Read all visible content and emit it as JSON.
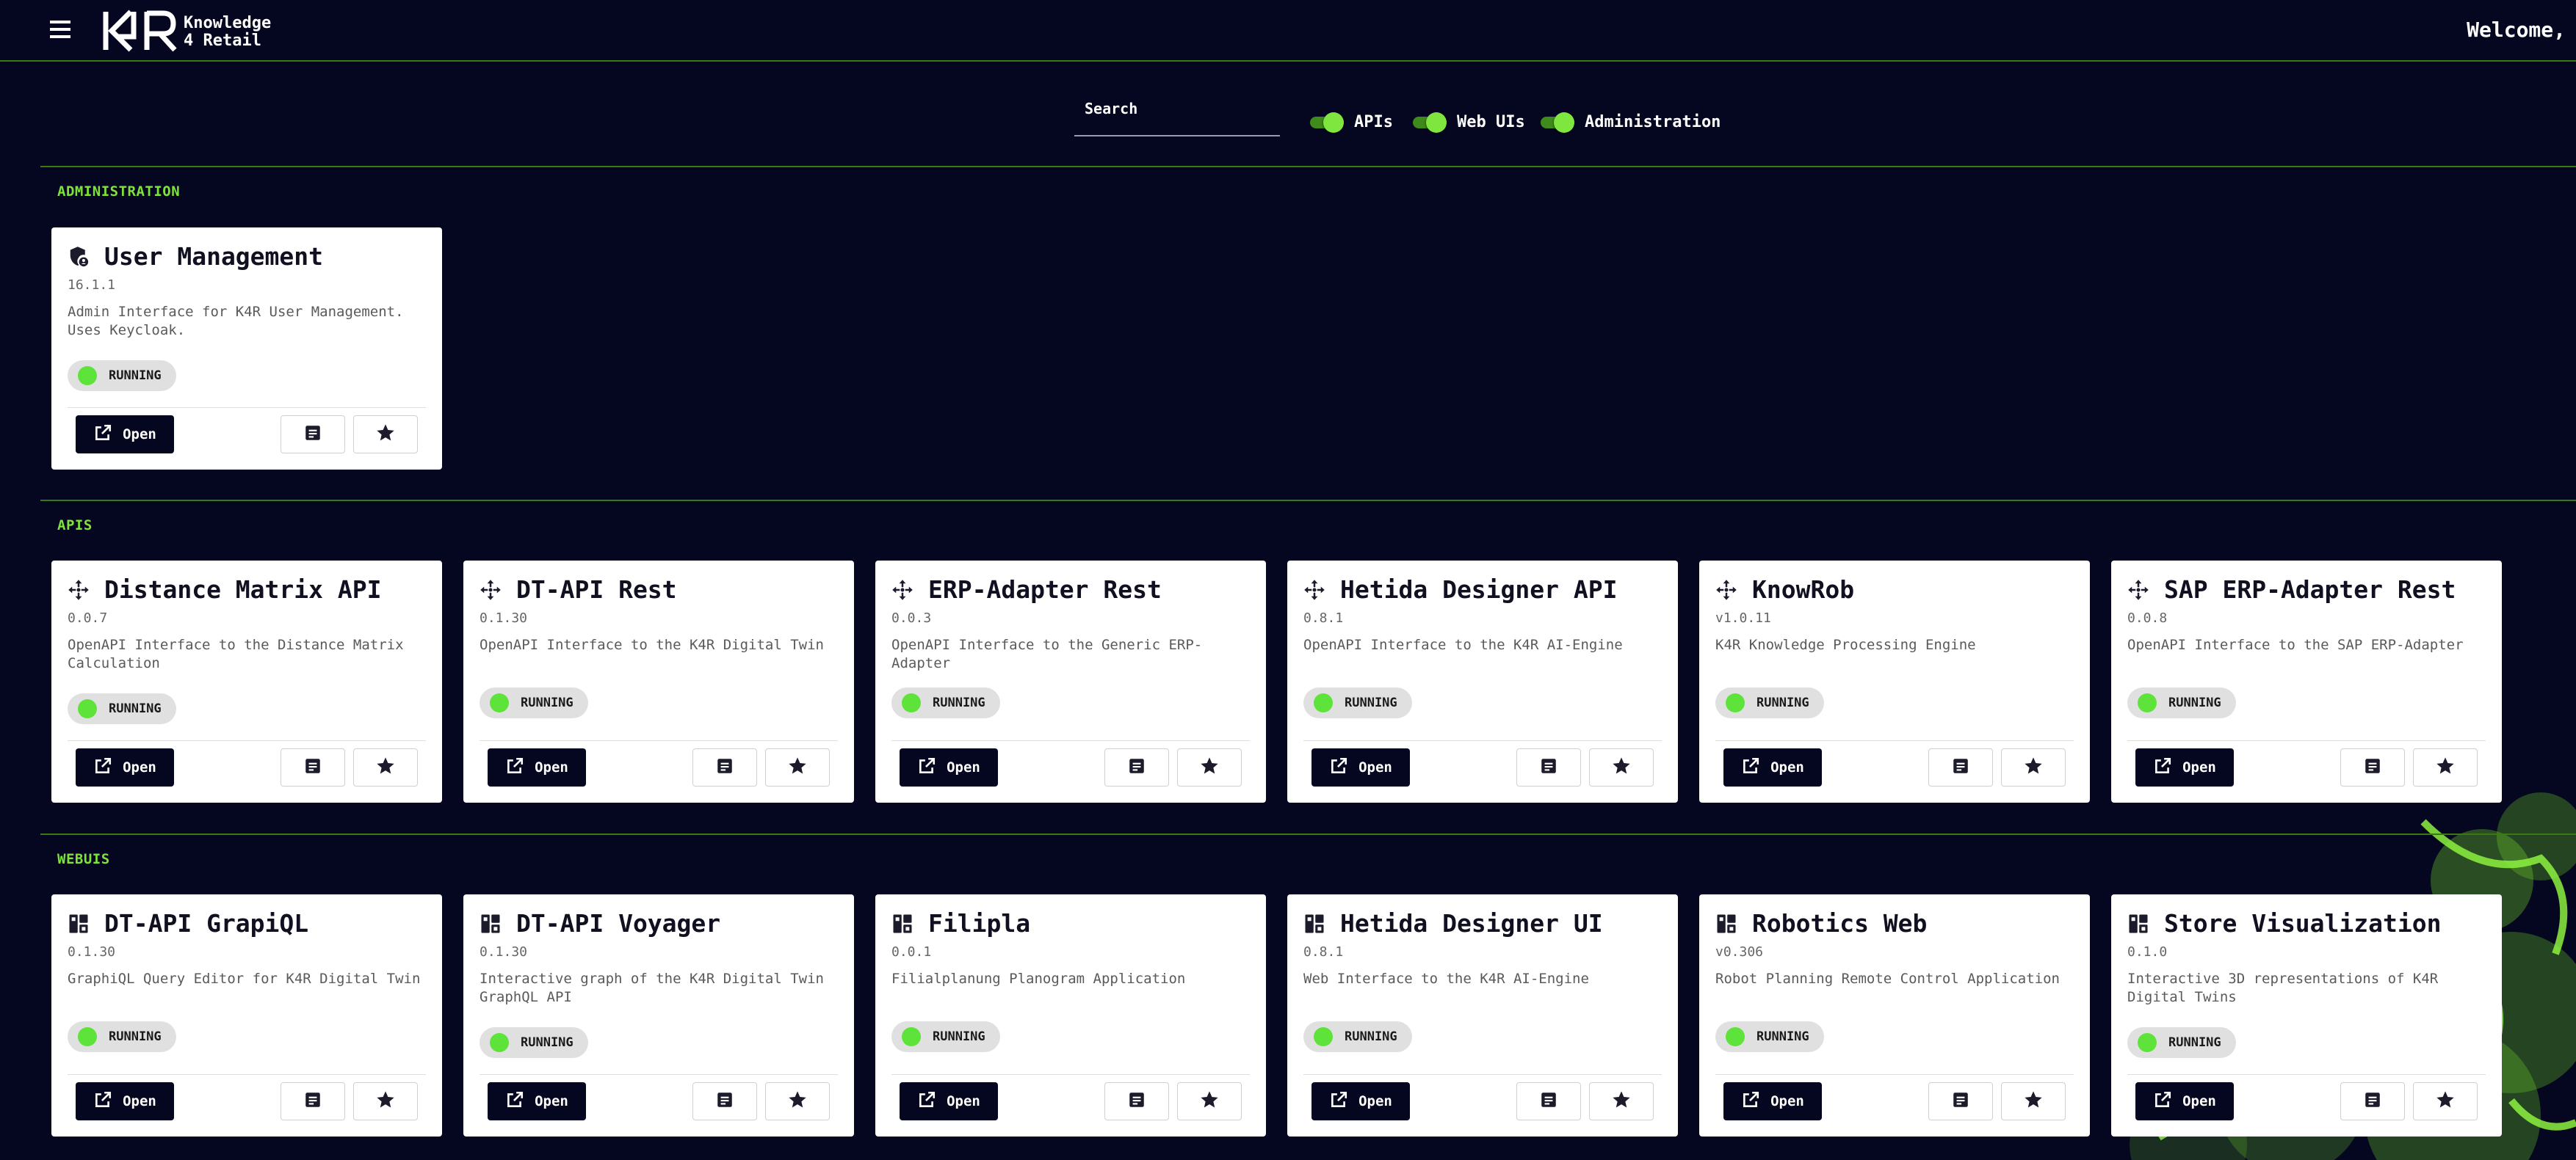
{
  "header": {
    "brand_line1": "Knowledge",
    "brand_line2": "4 Retail",
    "logo_text": "K4R",
    "welcome": "Welcome,"
  },
  "filters": {
    "search_label": "Search",
    "search_value": "",
    "toggles": [
      {
        "label": "APIs",
        "on": true
      },
      {
        "label": "Web UIs",
        "on": true
      },
      {
        "label": "Administration",
        "on": true
      }
    ]
  },
  "colors": {
    "background": "#05061f",
    "accent_green": "#7de33a",
    "status_green": "#5ee33a"
  },
  "common": {
    "open_label": "Open",
    "status_running": "RUNNING"
  },
  "sections": [
    {
      "title": "ADMINISTRATION",
      "cards": [
        {
          "icon": "admin-shield-icon",
          "title": "User Management",
          "version": "16.1.1",
          "description": "Admin Interface for K4R User Management. Uses Keycloak.",
          "status": "RUNNING"
        }
      ]
    },
    {
      "title": "APIS",
      "cards": [
        {
          "icon": "api-move-icon",
          "title": "Distance Matrix API",
          "version": "0.0.7",
          "description": "OpenAPI Interface to the Distance Matrix Calculation",
          "status": "RUNNING"
        },
        {
          "icon": "api-move-icon",
          "title": "DT-API Rest",
          "version": "0.1.30",
          "description": "OpenAPI Interface to the K4R Digital Twin",
          "status": "RUNNING"
        },
        {
          "icon": "api-move-icon",
          "title": "ERP-Adapter Rest",
          "version": "0.0.3",
          "description": "OpenAPI Interface to the Generic ERP-Adapter",
          "status": "RUNNING"
        },
        {
          "icon": "api-move-icon",
          "title": "Hetida Designer API",
          "version": "0.8.1",
          "description": "OpenAPI Interface to the K4R AI-Engine",
          "status": "RUNNING"
        },
        {
          "icon": "api-move-icon",
          "title": "KnowRob",
          "version": "v1.0.11",
          "description": "K4R Knowledge Processing Engine",
          "status": "RUNNING"
        },
        {
          "icon": "api-move-icon",
          "title": "SAP ERP-Adapter Rest",
          "version": "0.0.8",
          "description": "OpenAPI Interface to the SAP ERP-Adapter",
          "status": "RUNNING"
        }
      ]
    },
    {
      "title": "WEBUIS",
      "cards": [
        {
          "icon": "dashboard-icon",
          "title": "DT-API GrapiQL",
          "version": "0.1.30",
          "description": "GraphiQL Query Editor for K4R Digital Twin",
          "status": "RUNNING"
        },
        {
          "icon": "dashboard-icon",
          "title": "DT-API Voyager",
          "version": "0.1.30",
          "description": "Interactive graph of the K4R Digital Twin GraphQL API",
          "status": "RUNNING"
        },
        {
          "icon": "dashboard-icon",
          "title": "Filipla",
          "version": "0.0.1",
          "description": "Filialplanung Planogram Application",
          "status": "RUNNING"
        },
        {
          "icon": "dashboard-icon",
          "title": "Hetida Designer UI",
          "version": "0.8.1",
          "description": "Web Interface to the K4R AI-Engine",
          "status": "RUNNING"
        },
        {
          "icon": "dashboard-icon",
          "title": "Robotics Web",
          "version": "v0.306",
          "description": "Robot Planning Remote Control Application",
          "status": "RUNNING"
        },
        {
          "icon": "dashboard-icon",
          "title": "Store Visualization",
          "version": "0.1.0",
          "description": "Interactive 3D representations of K4R Digital Twins",
          "status": "RUNNING"
        }
      ]
    }
  ]
}
